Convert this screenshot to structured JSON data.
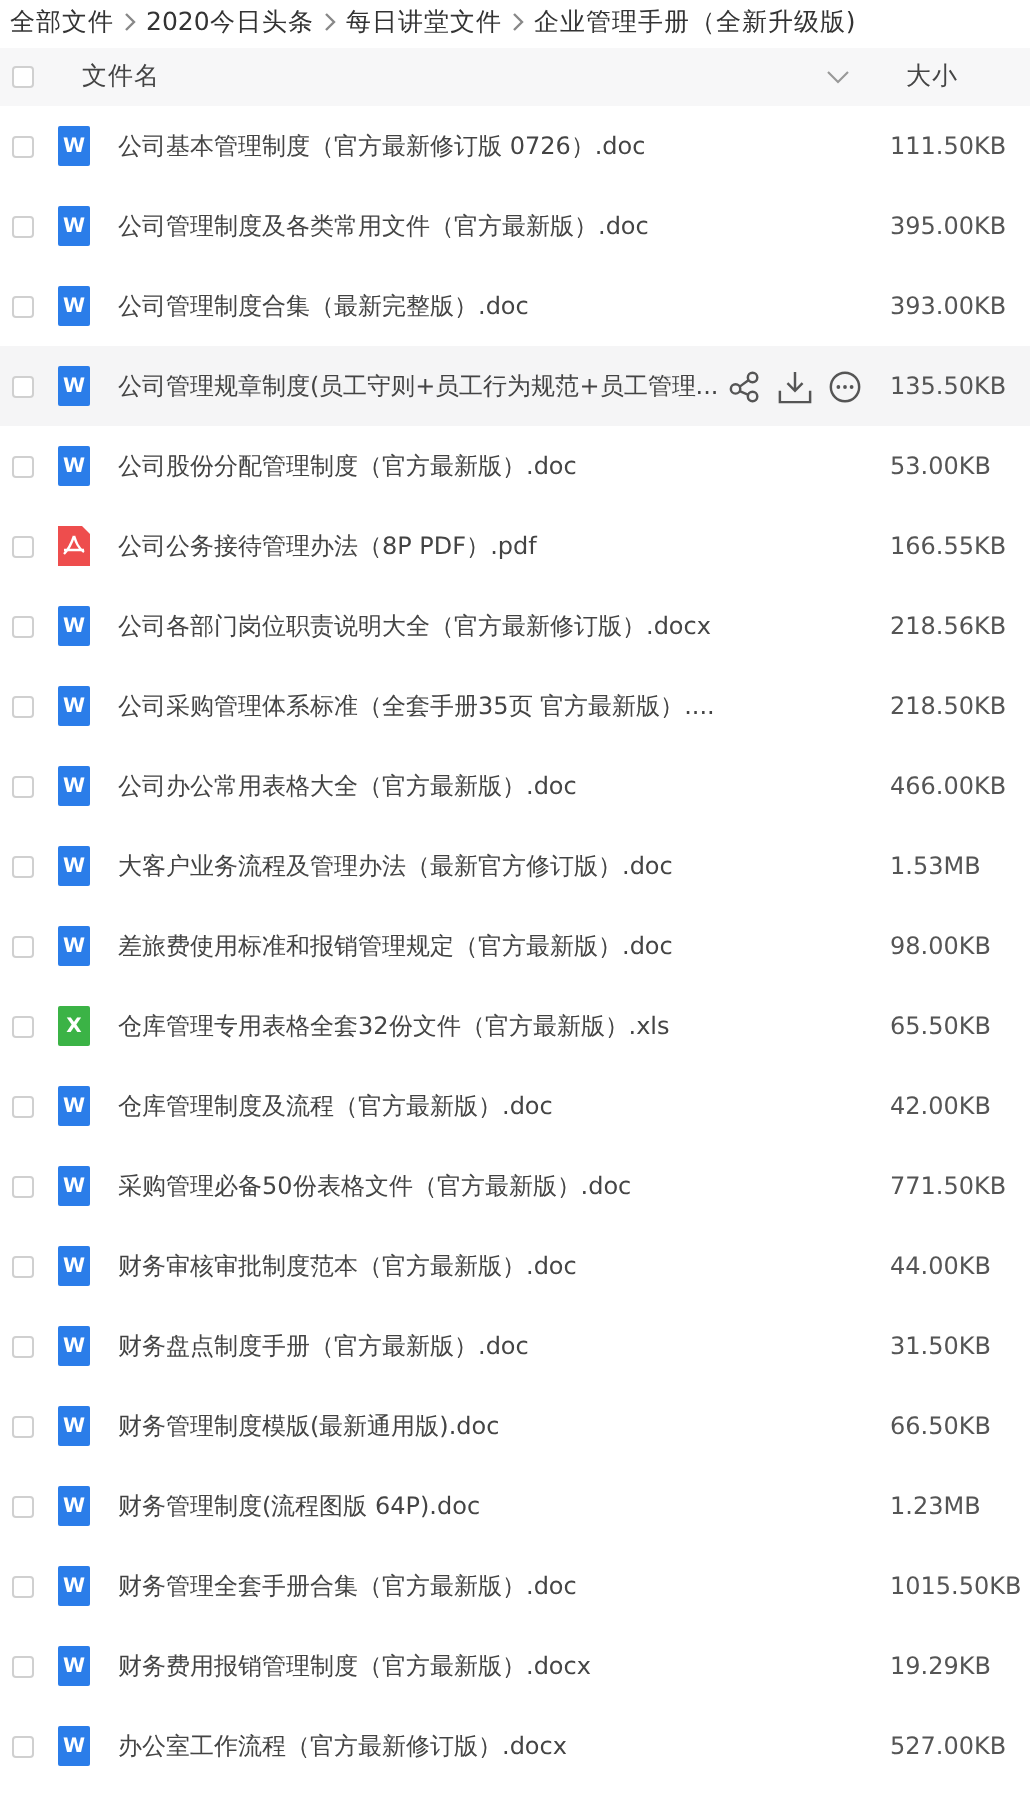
{
  "breadcrumb": [
    "全部文件",
    "2020今日头条",
    "每日讲堂文件",
    "企业管理手册（全新升级版)"
  ],
  "header": {
    "checked": false,
    "name": "文件名",
    "size": "大小"
  },
  "files": [
    {
      "kind": "doc",
      "icon_text": "W",
      "name": "公司基本管理制度（官方最新修订版 0726）.doc",
      "size": "111.50KB",
      "checked": false,
      "hovered": false
    },
    {
      "kind": "doc",
      "icon_text": "W",
      "name": "公司管理制度及各类常用文件（官方最新版）.doc",
      "size": "395.00KB",
      "checked": false,
      "hovered": false
    },
    {
      "kind": "doc",
      "icon_text": "W",
      "name": "公司管理制度合集（最新完整版）.doc",
      "size": "393.00KB",
      "checked": false,
      "hovered": false
    },
    {
      "kind": "doc",
      "icon_text": "W",
      "name": "公司管理规章制度(员工守则+员工行为规范+员工管理...",
      "size": "135.50KB",
      "checked": false,
      "hovered": true
    },
    {
      "kind": "doc",
      "icon_text": "W",
      "name": "公司股份分配管理制度（官方最新版）.doc",
      "size": "53.00KB",
      "checked": false,
      "hovered": false
    },
    {
      "kind": "pdf",
      "name": "公司公务接待管理办法（8P PDF）.pdf",
      "size": "166.55KB",
      "checked": false,
      "hovered": false
    },
    {
      "kind": "doc",
      "icon_text": "W",
      "name": "公司各部门岗位职责说明大全（官方最新修订版）.docx",
      "size": "218.56KB",
      "checked": false,
      "hovered": false
    },
    {
      "kind": "doc",
      "icon_text": "W",
      "name": "公司采购管理体系标准（全套手册35页 官方最新版）....",
      "size": "218.50KB",
      "checked": false,
      "hovered": false
    },
    {
      "kind": "doc",
      "icon_text": "W",
      "name": "公司办公常用表格大全（官方最新版）.doc",
      "size": "466.00KB",
      "checked": false,
      "hovered": false
    },
    {
      "kind": "doc",
      "icon_text": "W",
      "name": "大客户业务流程及管理办法（最新官方修订版）.doc",
      "size": "1.53MB",
      "checked": false,
      "hovered": false
    },
    {
      "kind": "doc",
      "icon_text": "W",
      "name": "差旅费使用标准和报销管理规定（官方最新版）.doc",
      "size": "98.00KB",
      "checked": false,
      "hovered": false
    },
    {
      "kind": "xls",
      "icon_text": "X",
      "name": "仓库管理专用表格全套32份文件（官方最新版）.xls",
      "size": "65.50KB",
      "checked": false,
      "hovered": false
    },
    {
      "kind": "doc",
      "icon_text": "W",
      "name": "仓库管理制度及流程（官方最新版）.doc",
      "size": "42.00KB",
      "checked": false,
      "hovered": false
    },
    {
      "kind": "doc",
      "icon_text": "W",
      "name": "采购管理必备50份表格文件（官方最新版）.doc",
      "size": "771.50KB",
      "checked": false,
      "hovered": false
    },
    {
      "kind": "doc",
      "icon_text": "W",
      "name": "财务审核审批制度范本（官方最新版）.doc",
      "size": "44.00KB",
      "checked": false,
      "hovered": false
    },
    {
      "kind": "doc",
      "icon_text": "W",
      "name": "财务盘点制度手册（官方最新版）.doc",
      "size": "31.50KB",
      "checked": false,
      "hovered": false
    },
    {
      "kind": "doc",
      "icon_text": "W",
      "name": "财务管理制度模版(最新通用版).doc",
      "size": "66.50KB",
      "checked": false,
      "hovered": false
    },
    {
      "kind": "doc",
      "icon_text": "W",
      "name": "财务管理制度(流程图版 64P).doc",
      "size": "1.23MB",
      "checked": false,
      "hovered": false
    },
    {
      "kind": "doc",
      "icon_text": "W",
      "name": "财务管理全套手册合集（官方最新版）.doc",
      "size": "1015.50KB",
      "checked": false,
      "hovered": false
    },
    {
      "kind": "doc",
      "icon_text": "W",
      "name": "财务费用报销管理制度（官方最新版）.docx",
      "size": "19.29KB",
      "checked": false,
      "hovered": false
    },
    {
      "kind": "doc",
      "icon_text": "W",
      "name": "办公室工作流程（官方最新修订版）.docx",
      "size": "527.00KB",
      "checked": false,
      "hovered": false
    }
  ]
}
